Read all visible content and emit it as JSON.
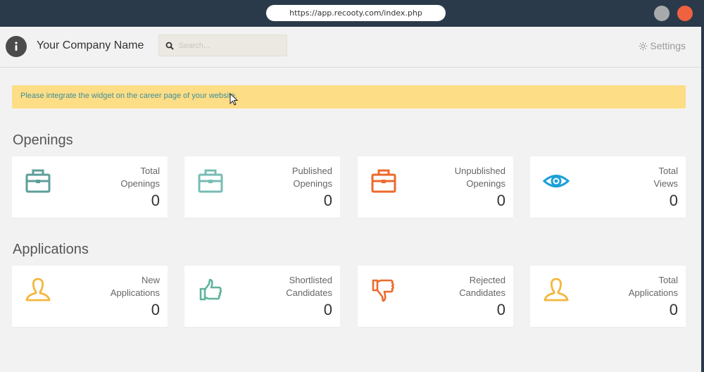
{
  "browser": {
    "url": "https://app.recooty.com/index.php"
  },
  "header": {
    "company_name": "Your Company Name",
    "search_placeholder": "Search...",
    "settings_label": "Settings"
  },
  "alert": {
    "text": "Please integrate the widget on the career page of your website."
  },
  "openings": {
    "title": "Openings",
    "cards": [
      {
        "label1": "Total",
        "label2": "Openings",
        "value": "0",
        "icon": "briefcase-icon",
        "color": "#5e9e9a"
      },
      {
        "label1": "Published",
        "label2": "Openings",
        "value": "0",
        "icon": "briefcase-icon",
        "color": "#77bdb4"
      },
      {
        "label1": "Unpublished",
        "label2": "Openings",
        "value": "0",
        "icon": "briefcase-icon",
        "color": "#ec6a2d"
      },
      {
        "label1": "Total",
        "label2": "Views",
        "value": "0",
        "icon": "eye-icon",
        "color": "#1a9fd8"
      }
    ]
  },
  "applications": {
    "title": "Applications",
    "cards": [
      {
        "label1": "New",
        "label2": "Applications",
        "value": "0",
        "icon": "user-icon",
        "color": "#f3b63c"
      },
      {
        "label1": "Shortlisted",
        "label2": "Candidates",
        "value": "0",
        "icon": "thumbs-up-icon",
        "color": "#5fb39c"
      },
      {
        "label1": "Rejected",
        "label2": "Candidates",
        "value": "0",
        "icon": "thumbs-down-icon",
        "color": "#ec6a2d"
      },
      {
        "label1": "Total",
        "label2": "Applications",
        "value": "0",
        "icon": "user-icon",
        "color": "#f3b63c"
      }
    ]
  }
}
